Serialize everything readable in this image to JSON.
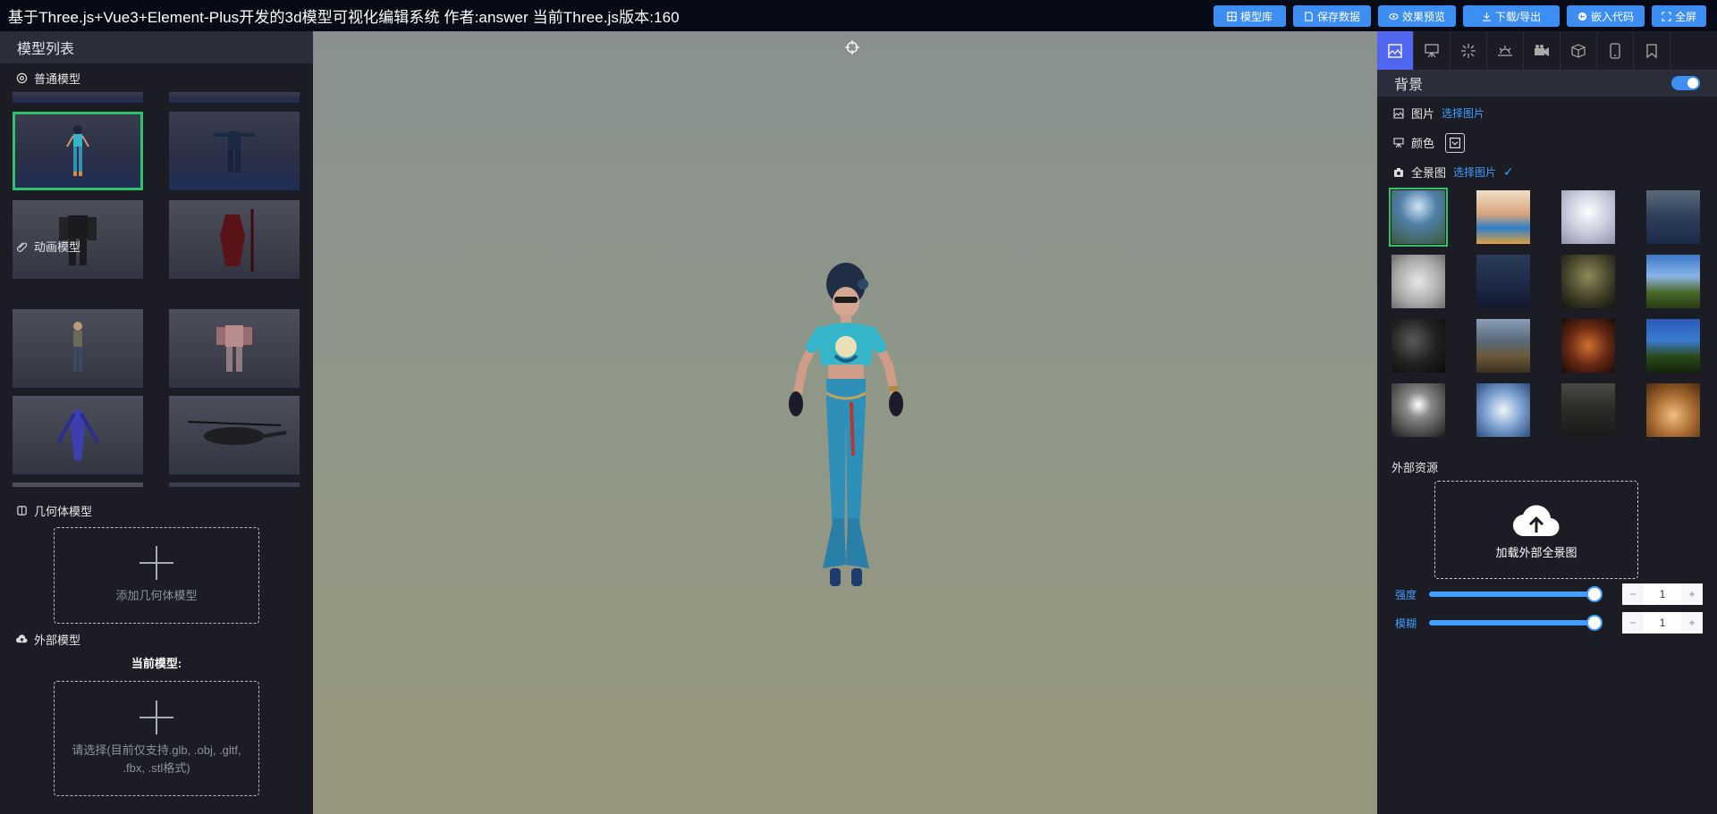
{
  "header": {
    "title": "基于Three.js+Vue3+Element-Plus开发的3d模型可视化编辑系统 作者:answer 当前Three.js版本:160",
    "buttons": [
      {
        "label": "模型库",
        "icon": "grid-icon"
      },
      {
        "label": "保存数据",
        "icon": "document-icon"
      },
      {
        "label": "效果预览",
        "icon": "eye-icon"
      },
      {
        "label": "下载/导出",
        "icon": "download-icon"
      },
      {
        "label": "嵌入代码",
        "icon": "code-icon"
      },
      {
        "label": "全屏",
        "icon": "fullscreen-icon"
      }
    ]
  },
  "left": {
    "title": "模型列表",
    "normal_models": {
      "label": "普通模型"
    },
    "animation_models": {
      "label": "动画模型"
    },
    "geometry_models": {
      "label": "几何体模型",
      "add_label": "添加几何体模型"
    },
    "external_models": {
      "label": "外部模型",
      "current_label": "当前模型:",
      "upload_hint": "请选择(目前仅支持.glb, .obj, .gltf, .fbx, .stl格式)"
    }
  },
  "right": {
    "tabs": [
      "image-icon",
      "easel-icon",
      "sparkle-icon",
      "sunrise-icon",
      "camera-icon",
      "box-icon",
      "phone-icon",
      "bookmark-icon"
    ],
    "background": {
      "title": "背景",
      "enabled": true
    },
    "image": {
      "label": "图片",
      "action": "选择图片"
    },
    "color": {
      "label": "颜色"
    },
    "panorama": {
      "label": "全景图",
      "action": "选择图片",
      "check": "✓"
    },
    "external_resources": {
      "title": "外部资源",
      "upload_label": "加载外部全景图"
    },
    "intensity": {
      "label": "强度",
      "value": "1",
      "fraction": 1
    },
    "blur": {
      "label": "模糊",
      "value": "1",
      "fraction": 1
    },
    "colors": {
      "accent": "#3d8ef2",
      "active_tab": "#5167f0",
      "selected": "#2ec36b"
    }
  }
}
